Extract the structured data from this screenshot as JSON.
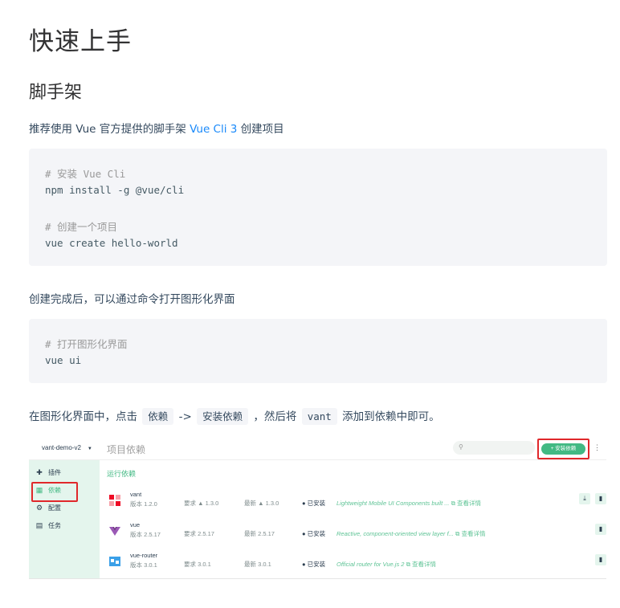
{
  "title": "快速上手",
  "section": "脚手架",
  "intro": {
    "before": "推荐使用 Vue 官方提供的脚手架",
    "link": "Vue Cli 3",
    "after": "创建项目"
  },
  "code1": {
    "comment1": "# 安装 Vue Cli",
    "cmd1": "npm install -g @vue/cli",
    "comment2": "# 创建一个项目",
    "cmd2": "vue create hello-world"
  },
  "after_create": "创建完成后，可以通过命令打开图形化界面",
  "code2": {
    "comment": "# 打开图形化界面",
    "cmd": "vue ui"
  },
  "instructions": {
    "t1": "在图形化界面中，点击",
    "c1": "依赖",
    "arrow": "->",
    "c2": "安装依赖",
    "t2": "，然后将",
    "c3": "vant",
    "t3": "添加到依赖中即可。"
  },
  "screenshot": {
    "project": "vant-demo-v2",
    "page_title": "项目依赖",
    "install_button": "+ 安装依赖",
    "nav": [
      "插件",
      "依赖",
      "配置",
      "任务"
    ],
    "section": "运行依赖",
    "deps": [
      {
        "name": "vant",
        "version": "版本 1.2.0",
        "required": "要求 ▲ 1.3.0",
        "latest": "最新 ▲ 1.3.0",
        "installed": "已安装",
        "desc": "Lightweight Mobile UI Components built ...",
        "details": "查看详情"
      },
      {
        "name": "vue",
        "version": "版本 2.5.17",
        "required": "要求 2.5.17",
        "latest": "最新 2.5.17",
        "installed": "已安装",
        "desc": "Reactive, component-oriented view layer f...",
        "details": "查看详情"
      },
      {
        "name": "vue-router",
        "version": "版本 3.0.1",
        "required": "要求 3.0.1",
        "latest": "最新 3.0.1",
        "installed": "已安装",
        "desc": "Official router for Vue.js 2",
        "details": "查看详情"
      }
    ]
  },
  "colors": {
    "accent": "#42b983",
    "link": "#1989fa",
    "highlight": "#e0282b",
    "code_bg": "#f4f5f8"
  }
}
